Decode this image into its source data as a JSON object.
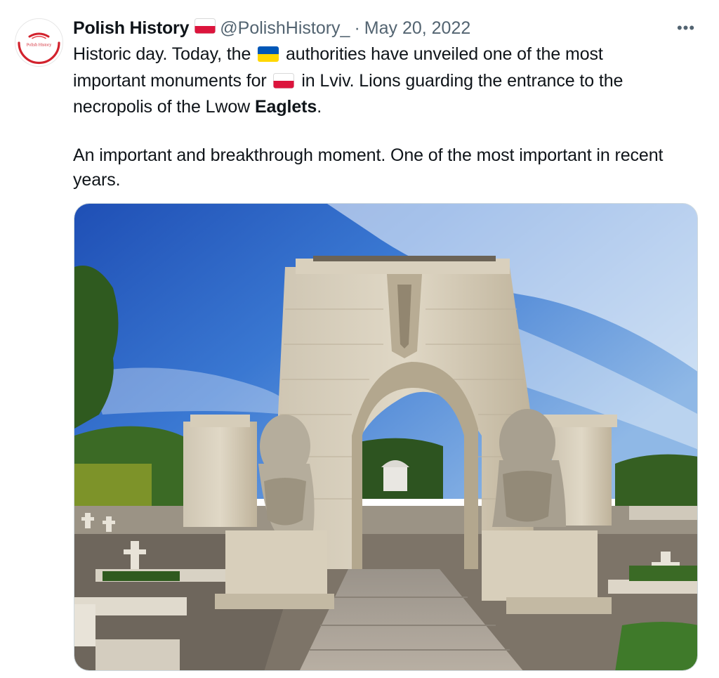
{
  "tweet": {
    "author": {
      "display_name": "Polish History",
      "handle": "@PolishHistory_",
      "avatar_text": "Polish History",
      "name_flag_icon": "poland-flag-icon"
    },
    "separator": "·",
    "date": "May 20, 2022",
    "more_label": "•••",
    "text": {
      "line_1a": "Historic day. Today, the",
      "line_1b": "authorities have unveiled one of the most",
      "line_2a": "important monuments for",
      "line_2b": "in Lviv. Lions guarding the entrance to the",
      "line_3a": "necropolis of the Lwow",
      "line_3b": "Eaglets",
      "line_3c": ".",
      "para_2": "An important and breakthrough moment. One of the most important in recent years.",
      "flag_1_icon": "ukraine-flag-icon",
      "flag_2_icon": "poland-flag-icon"
    },
    "media": {
      "image_icon": "photo-of-memorial-arch-with-lion-statues"
    },
    "colors": {
      "text": "#0f1419",
      "secondary": "#536471",
      "poland_white": "#ffffff",
      "poland_red": "#dc143c",
      "ukraine_blue": "#0057b7",
      "ukraine_yellow": "#ffd700",
      "brand_red": "#d2222d"
    }
  }
}
